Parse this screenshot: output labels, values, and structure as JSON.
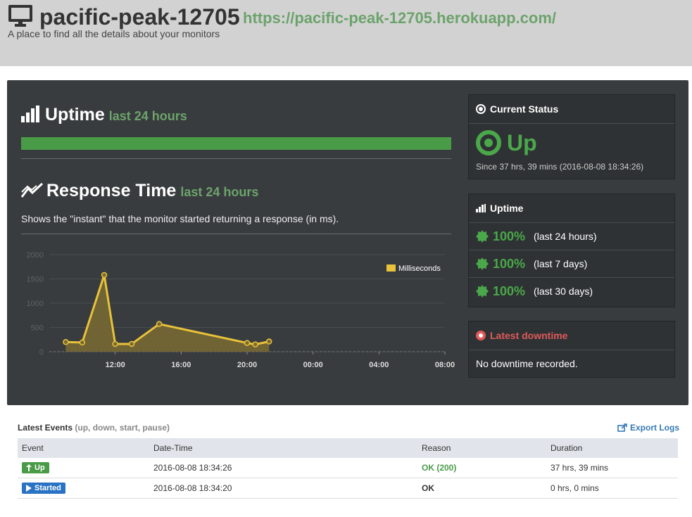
{
  "header": {
    "title": "pacific-peak-12705",
    "url": "https://pacific-peak-12705.herokuapp.com/",
    "tagline": "A place to find all the details about your monitors"
  },
  "uptime_section": {
    "title": "Uptime",
    "subtitle": "last 24 hours",
    "bar_fraction": 1.0
  },
  "response_section": {
    "title": "Response Time",
    "subtitle": "last 24 hours",
    "description": "Shows the \"instant\" that the monitor started returning a response (in ms)."
  },
  "chart_data": {
    "type": "area",
    "series": [
      {
        "name": "Milliseconds",
        "color": "#e8c23a",
        "x": [
          "09:00",
          "10:00",
          "11:20",
          "12:00",
          "13:00",
          "14:40",
          "20:00",
          "20:30",
          "21:20"
        ],
        "values": [
          200,
          190,
          1580,
          160,
          160,
          570,
          180,
          150,
          210
        ]
      }
    ],
    "x_ticks": [
      "12:00",
      "16:00",
      "20:00",
      "00:00",
      "04:00",
      "08:00"
    ],
    "y_ticks": [
      "0",
      "500",
      "1000",
      "1500",
      "2000"
    ],
    "ylim": [
      0,
      2000
    ],
    "legend": "top-right",
    "grid": true
  },
  "status_panel": {
    "title": "Current Status",
    "state": "Up",
    "since": "Since 37 hrs, 39 mins (2016-08-08 18:34:26)",
    "color": "#4aa84a"
  },
  "uptime_panel": {
    "title": "Uptime",
    "rows": [
      {
        "pct": "100%",
        "label": "(last 24 hours)"
      },
      {
        "pct": "100%",
        "label": "(last 7 days)"
      },
      {
        "pct": "100%",
        "label": "(last 30 days)"
      }
    ]
  },
  "downtime_panel": {
    "title": "Latest downtime",
    "text": "No downtime recorded.",
    "color": "#e05a5a"
  },
  "events": {
    "title": "Latest Events",
    "subtitle": "(up, down, start, pause)",
    "export_label": "Export Logs",
    "columns": [
      "Event",
      "Date-Time",
      "Reason",
      "Duration"
    ],
    "rows": [
      {
        "event": "Up",
        "datetime": "2016-08-08 18:34:26",
        "reason": "OK (200)",
        "duration": "37 hrs, 39 mins"
      },
      {
        "event": "Started",
        "datetime": "2016-08-08 18:34:20",
        "reason": "OK",
        "duration": "0 hrs, 0 mins"
      }
    ]
  }
}
